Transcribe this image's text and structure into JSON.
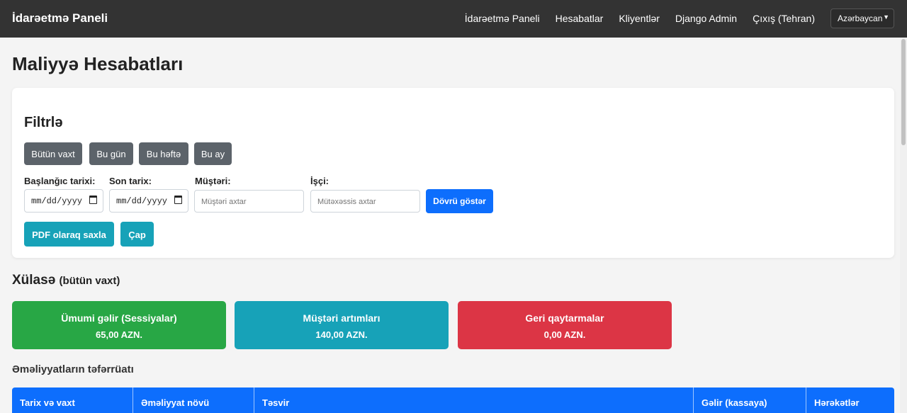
{
  "navbar": {
    "brand": "İdarəetmə Paneli",
    "links": [
      "İdarəetmə Paneli",
      "Hesabatlar",
      "Kliyentlər",
      "Django Admin",
      "Çıxış (Tehran)"
    ],
    "language": "Azərbaycan",
    "language_icon": "chevron-down-icon"
  },
  "page": {
    "title": "Maliyyə Hesabatları"
  },
  "filter": {
    "title": "Filtrlə",
    "period_buttons": [
      "Bütün vaxt",
      "Bu gün",
      "Bu həftə",
      "Bu ay"
    ],
    "start_date_label": "Başlanğıc tarixi:",
    "start_date_value": "mm/dd/yyyy",
    "end_date_label": "Son tarix:",
    "end_date_value": "mm/dd/yyyy",
    "customer_label": "Müştəri:",
    "customer_placeholder": "Müştəri axtar",
    "employee_label": "İşçi:",
    "employee_placeholder": "Mütəxəssis axtar",
    "show_button": "Dövrü göstər",
    "pdf_button": "PDF olaraq saxla",
    "print_button": "Çap"
  },
  "summary": {
    "title": "Xülasə",
    "subtitle": "(bütün vaxt)",
    "cards": [
      {
        "title": "Ümumi gəlir (Sessiyalar)",
        "value": "65,00 AZN.",
        "color": "#28a745"
      },
      {
        "title": "Müştəri artımları",
        "value": "140,00 AZN.",
        "color": "#17a2b8"
      },
      {
        "title": "Geri qaytarmalar",
        "value": "0,00 AZN.",
        "color": "#dc3545"
      }
    ]
  },
  "details": {
    "title": "Əməliyyatların təfərrüatı",
    "columns": [
      "Tarix və vaxt",
      "Əməliyyat növü",
      "Təsvir",
      "Gəlir (kassaya)",
      "Hərəkətlər"
    ]
  },
  "colors": {
    "navbar": "#333333",
    "primary": "#0d6efd",
    "secondary": "#5c636a",
    "info": "#17a2b8"
  }
}
